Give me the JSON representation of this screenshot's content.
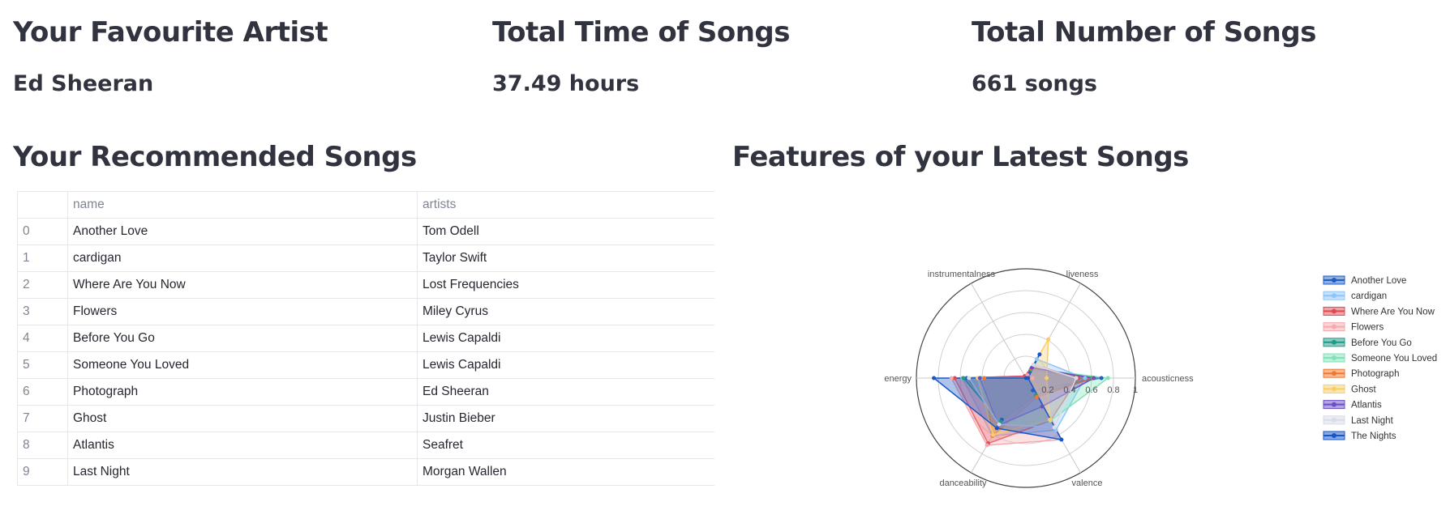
{
  "metrics": [
    {
      "label": "Your Favourite Artist",
      "value": "Ed Sheeran"
    },
    {
      "label": "Total Time of Songs",
      "value": "37.49 hours"
    },
    {
      "label": "Total Number of Songs",
      "value": "661 songs"
    }
  ],
  "recommended": {
    "title": "Your Recommended Songs",
    "columns": [
      "",
      "name",
      "artists"
    ],
    "rows": [
      [
        "0",
        "Another Love",
        "Tom Odell"
      ],
      [
        "1",
        "cardigan",
        "Taylor Swift"
      ],
      [
        "2",
        "Where Are You Now",
        "Lost Frequencies"
      ],
      [
        "3",
        "Flowers",
        "Miley Cyrus"
      ],
      [
        "4",
        "Before You Go",
        "Lewis Capaldi"
      ],
      [
        "5",
        "Someone You Loved",
        "Lewis Capaldi"
      ],
      [
        "6",
        "Photograph",
        "Ed Sheeran"
      ],
      [
        "7",
        "Ghost",
        "Justin Bieber"
      ],
      [
        "8",
        "Atlantis",
        "Seafret"
      ],
      [
        "9",
        "Last Night",
        "Morgan Wallen"
      ]
    ]
  },
  "features_title": "Features of your Latest Songs",
  "chart_data": {
    "type": "radar",
    "axes": [
      "acousticness",
      "liveness",
      "instrumentalness",
      "energy",
      "danceability",
      "valence"
    ],
    "radial_ticks": [
      0.2,
      0.4,
      0.6,
      0.8,
      1
    ],
    "range": [
      0,
      1
    ],
    "legend_position": "right",
    "series": [
      {
        "name": "Another Love",
        "color": "#1f5fc4",
        "values": [
          0.69,
          0.09,
          0.02,
          0.54,
          0.44,
          0.13
        ]
      },
      {
        "name": "cardigan",
        "color": "#8ec5f7",
        "values": [
          0.54,
          0.2,
          0.02,
          0.58,
          0.61,
          0.55
        ]
      },
      {
        "name": "Where Are You Now",
        "color": "#e04a52",
        "values": [
          0.48,
          0.14,
          0.02,
          0.65,
          0.69,
          0.45
        ]
      },
      {
        "name": "Flowers",
        "color": "#f6a9b0",
        "values": [
          0.06,
          0.03,
          0.0,
          0.68,
          0.71,
          0.65
        ]
      },
      {
        "name": "Before You Go",
        "color": "#1f9a8a",
        "values": [
          0.6,
          0.09,
          0.0,
          0.57,
          0.46,
          0.18
        ]
      },
      {
        "name": "Someone You Loved",
        "color": "#7fe2b8",
        "values": [
          0.75,
          0.1,
          0.0,
          0.41,
          0.5,
          0.45
        ]
      },
      {
        "name": "Photograph",
        "color": "#f0782f",
        "values": [
          0.61,
          0.1,
          0.0,
          0.38,
          0.61,
          0.2
        ]
      },
      {
        "name": "Ghost",
        "color": "#f7ce6a",
        "values": [
          0.19,
          0.41,
          0.0,
          0.44,
          0.6,
          0.44
        ]
      },
      {
        "name": "Atlantis",
        "color": "#6a4fc4",
        "values": [
          0.62,
          0.11,
          0.0,
          0.42,
          0.5,
          0.3
        ]
      },
      {
        "name": "Last Night",
        "color": "#d8dbe8",
        "values": [
          0.46,
          0.14,
          0.0,
          0.52,
          0.49,
          0.52
        ]
      },
      {
        "name": "The Nights",
        "color": "#1656c7",
        "values": [
          0.02,
          0.25,
          0.0,
          0.84,
          0.53,
          0.65
        ]
      }
    ]
  }
}
